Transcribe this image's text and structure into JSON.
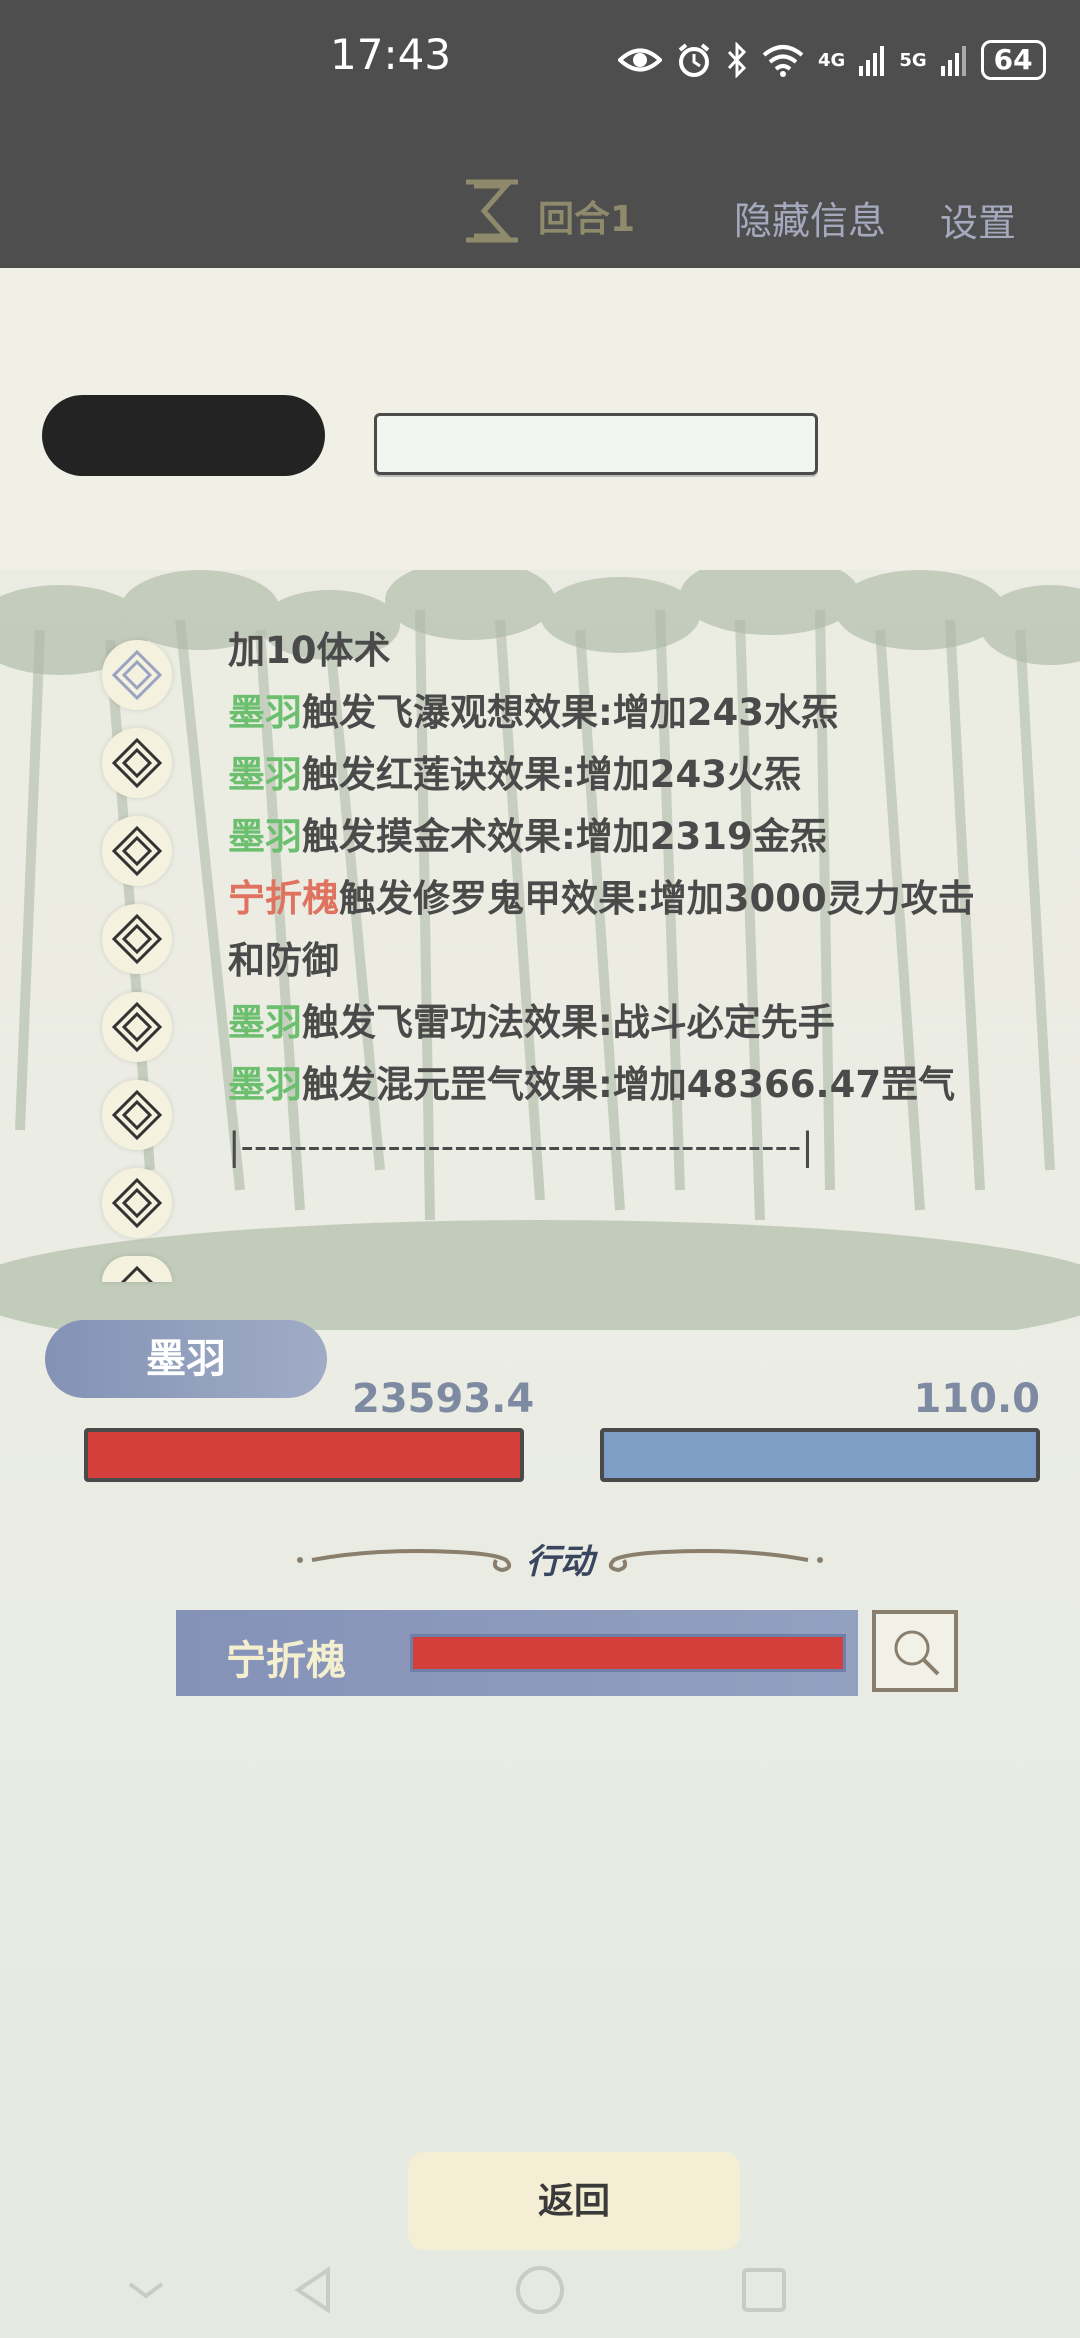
{
  "status_bar": {
    "time": "17:43",
    "network_4g": "4G",
    "network_5g": "5G",
    "battery": "64"
  },
  "header": {
    "round_label": "回合1",
    "hide_info_label": "隐藏信息",
    "settings_label": "设置"
  },
  "log": {
    "lines": [
      {
        "name": "",
        "text": "加10体术"
      },
      {
        "name": "墨羽",
        "text": "触发飞瀑观想效果:增加243水炁"
      },
      {
        "name": "墨羽",
        "text": "触发红莲诀效果:增加243火炁"
      },
      {
        "name": "墨羽",
        "text": "触发摸金术效果:增加2319金炁"
      },
      {
        "name": "宁折槐",
        "text": "触发修罗鬼甲效果:增加3000灵力攻击和防御"
      },
      {
        "name": "墨羽",
        "text": "触发飞雷功法效果:战斗必定先手"
      },
      {
        "name": "墨羽",
        "text": "触发混元罡气效果:增加48366.47罡气"
      },
      {
        "name": "",
        "text": "|------------------------------------------|"
      }
    ]
  },
  "character": {
    "name": "墨羽",
    "hp_value": "23593.4",
    "mp_value": "110.0",
    "hp_color": "#d33f3b",
    "mp_color": "#7f9ec6"
  },
  "action": {
    "label": "行动",
    "target_name": "宁折槐",
    "target_hp_fraction": 1.0
  },
  "footer": {
    "back_label": "返回"
  },
  "icons": [
    "hourglass-icon",
    "diamond-icon",
    "search-icon",
    "nav-down-icon",
    "nav-back-icon",
    "nav-home-icon",
    "nav-recents-icon"
  ],
  "colors": {
    "ally_name": "#6bbf6e",
    "enemy_name": "#e0735f"
  }
}
